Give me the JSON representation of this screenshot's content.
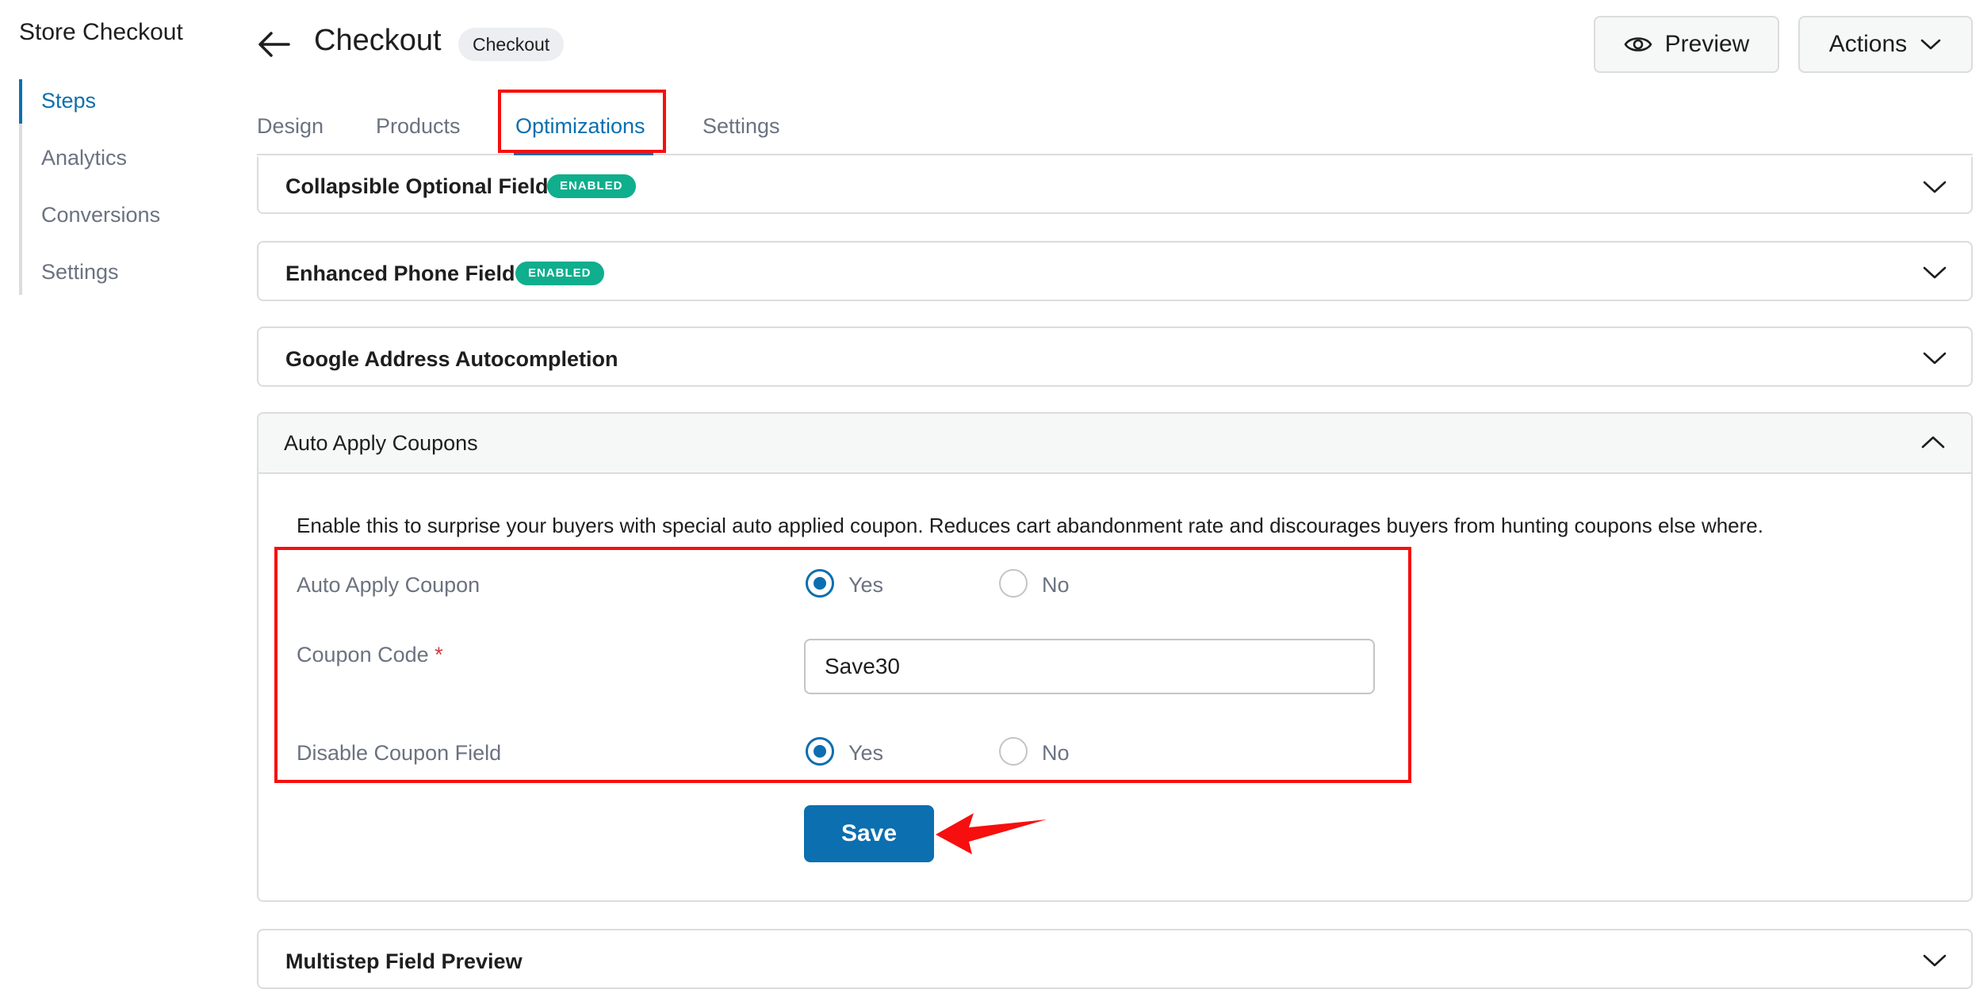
{
  "sidebar": {
    "title": "Store Checkout",
    "items": [
      {
        "label": "Steps",
        "active": true
      },
      {
        "label": "Analytics",
        "active": false
      },
      {
        "label": "Conversions",
        "active": false
      },
      {
        "label": "Settings",
        "active": false
      }
    ]
  },
  "header": {
    "title": "Checkout",
    "badge": "Checkout",
    "preview_label": "Preview",
    "actions_label": "Actions"
  },
  "tabs": [
    {
      "label": "Design",
      "active": false
    },
    {
      "label": "Products",
      "active": false
    },
    {
      "label": "Optimizations",
      "active": true
    },
    {
      "label": "Settings",
      "active": false
    }
  ],
  "panels": {
    "collapsible": {
      "title": "Collapsible Optional Field",
      "badge": "ENABLED"
    },
    "phone": {
      "title": "Enhanced Phone Field",
      "badge": "ENABLED"
    },
    "google": {
      "title": "Google Address Autocompletion"
    },
    "coupons": {
      "title": "Auto Apply Coupons",
      "description": "Enable this to surprise your buyers with special auto applied coupon. Reduces cart abandonment rate and discourages buyers from hunting coupons else where.",
      "auto_apply": {
        "label": "Auto Apply Coupon",
        "yes": "Yes",
        "no": "No",
        "selected": "Yes"
      },
      "coupon_code": {
        "label": "Coupon Code",
        "required_mark": "*",
        "value": "Save30"
      },
      "disable_field": {
        "label": "Disable Coupon Field",
        "yes": "Yes",
        "no": "No",
        "selected": "Yes"
      },
      "save_label": "Save"
    },
    "multistep": {
      "title": "Multistep Field Preview"
    }
  },
  "colors": {
    "accent": "#0b6fb0",
    "enabled_badge": "#0fae8d",
    "annotation_red": "#f70e0e"
  },
  "icons": [
    "back-arrow-icon",
    "eye-icon",
    "chevron-down-icon",
    "chevron-up-icon"
  ]
}
